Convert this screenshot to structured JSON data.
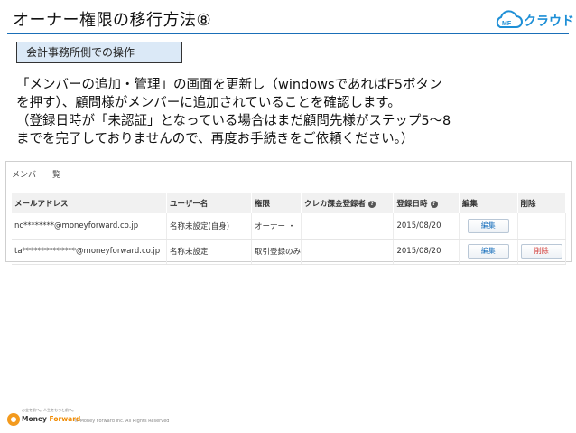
{
  "slide": {
    "title": "オーナー権限の移行方法⑧",
    "brand_text": "クラウド",
    "brand_prefix": "MF",
    "section_tag": "会計事務所側での操作",
    "instructions": [
      "「メンバーの追加・管理」の画面を更新し（windowsであればF5ボタン",
      "を押す）、顧問様がメンバーに追加されていることを確認します。",
      "（登録日時が「未認証」となっている場合はまだ顧問先様がステップ5〜8",
      "までを完了しておりませんので、再度お手続きをご依頼ください。）"
    ]
  },
  "screen": {
    "title": "メンバー一覧",
    "columns": [
      "メールアドレス",
      "ユーザー名",
      "権限",
      "クレカ課金登録者",
      "登録日時",
      "編集",
      "削除"
    ],
    "rows": [
      {
        "email": "nc********@moneyforward.co.jp",
        "username": "名称未設定(自身)",
        "role": "オーナー ・",
        "card_payer": "",
        "registered": "2015/08/20",
        "edit_label": "編集",
        "delete_label": ""
      },
      {
        "email": "ta**************@moneyforward.co.jp",
        "username": "名称未設定",
        "role": "取引登録のみ",
        "card_payer": "",
        "registered": "2015/08/20",
        "edit_label": "編集",
        "delete_label": "削除"
      }
    ]
  },
  "footer": {
    "logo_tagline": "お金を前へ。人生をもっと前へ。",
    "logo_text_a": "Money ",
    "logo_text_b": "Forward",
    "copyright": "© Money Forward Inc. All Rights Reserved"
  },
  "colors": {
    "title_rule": "#1a6fb8",
    "section_tag_bg": "#dbe9f7",
    "brand": "#1e8fd6",
    "edit_text": "#1e73be",
    "delete_text": "#d0312d",
    "footer_accent": "#f39a1e"
  },
  "icons": {
    "brand": "cloud-icon",
    "help": "question-circle-icon",
    "footer": "moneyforward-logo"
  }
}
